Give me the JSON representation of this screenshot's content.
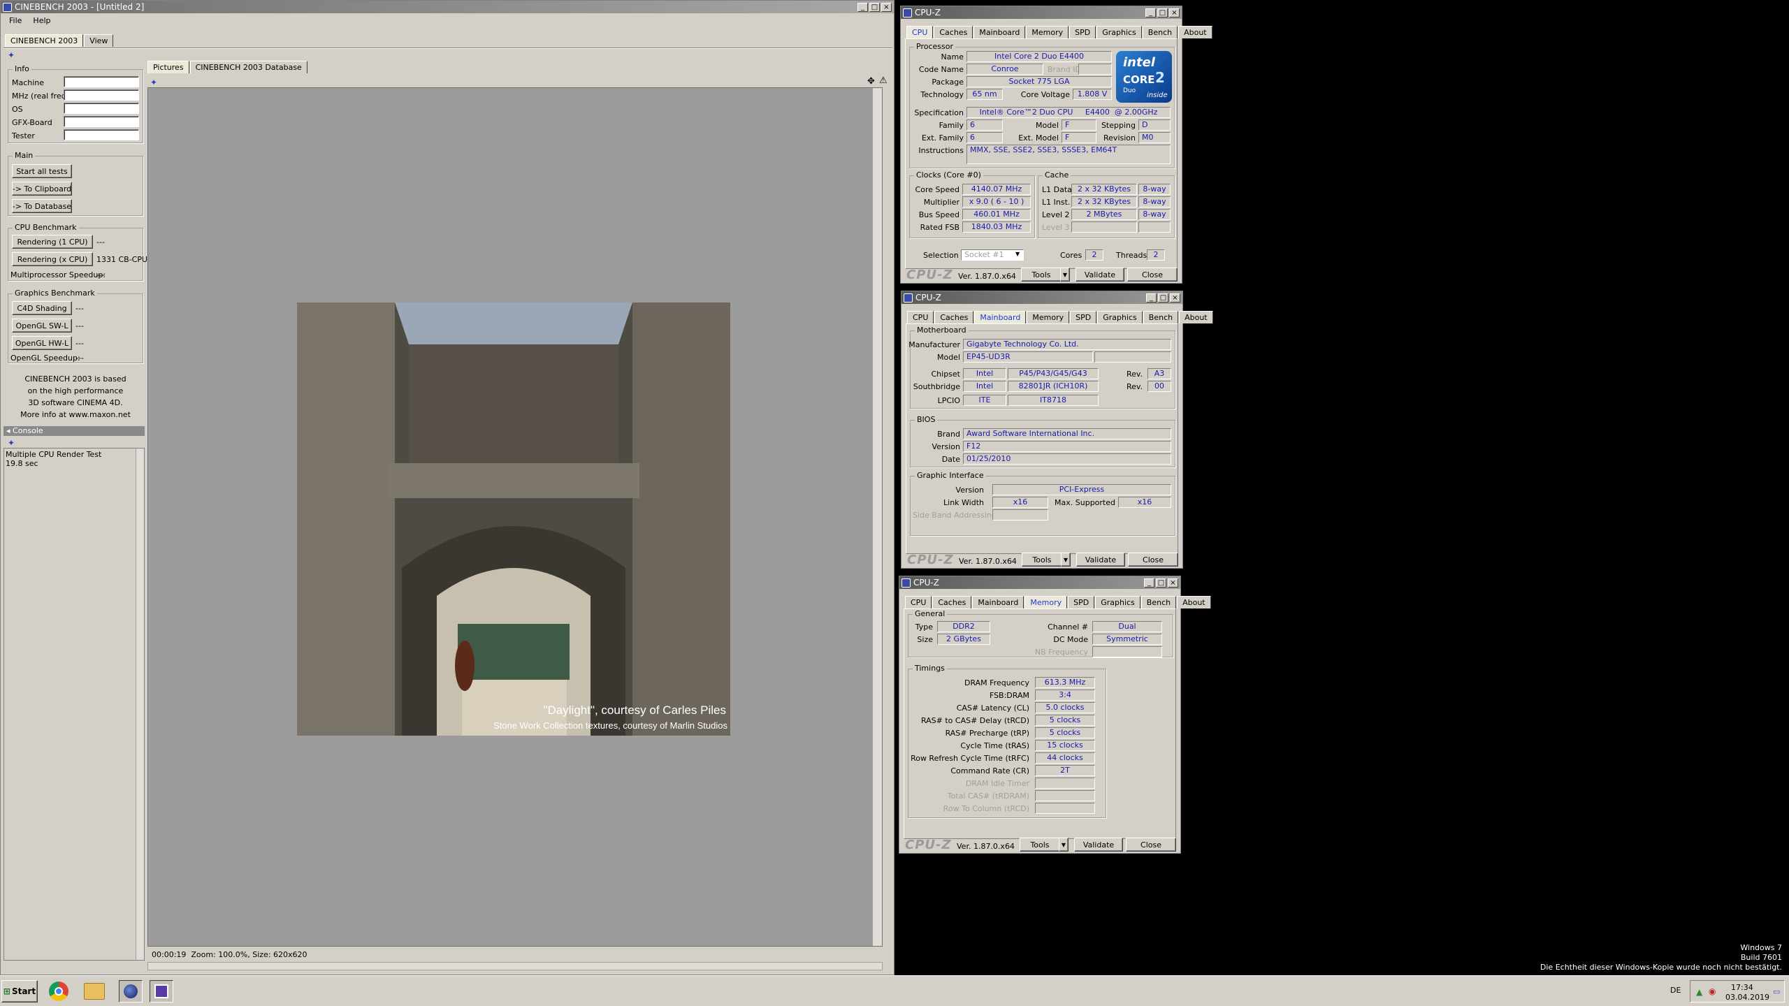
{
  "cb": {
    "title": "CINEBENCH 2003 - [Untitled 2]",
    "menu": [
      "File",
      "Help"
    ],
    "tabs": [
      "CINEBENCH 2003",
      "View"
    ],
    "info": {
      "title": "Info",
      "labels": [
        "Machine",
        "MHz (real freq.)",
        "OS",
        "GFX-Board",
        "Tester"
      ]
    },
    "main": {
      "title": "Main",
      "buttons": [
        "Start all tests",
        "-> To Clipboard",
        "-> To Database"
      ]
    },
    "cpu": {
      "title": "CPU Benchmark",
      "r1": "Rendering (1 CPU)",
      "r1v": "---",
      "rx": "Rendering (x CPU)",
      "rxv": "1331 CB-CPU",
      "mp": "Multiprocessor Speedup:",
      "mpv": "---"
    },
    "gfx": {
      "title": "Graphics Benchmark",
      "b": [
        "C4D Shading",
        "OpenGL SW-L",
        "OpenGL HW-L"
      ],
      "bv": "---",
      "sp": "OpenGL Speedup:",
      "spv": "---"
    },
    "about": [
      "CINEBENCH 2003 is based",
      "on the high performance",
      "3D software CINEMA 4D.",
      "More info at www.maxon.net"
    ],
    "console": {
      "title": "Console",
      "lines": [
        "Multiple CPU Render Test",
        "19.8 sec"
      ]
    },
    "pictabs": [
      "Pictures",
      "CINEBENCH 2003 Database"
    ],
    "caption1": "\"Daylight\", courtesy of Carles Piles",
    "caption2": "Stone Work Collection textures, courtesy of Marlin Studios",
    "status": "00:00:19  Zoom: 100.0%, Size: 620x620"
  },
  "cz": {
    "title": "CPU-Z",
    "tabs": [
      "CPU",
      "Caches",
      "Mainboard",
      "Memory",
      "SPD",
      "Graphics",
      "Bench",
      "About"
    ],
    "ver": "Ver. 1.87.0.x64",
    "tools": "Tools",
    "validate": "Validate",
    "close": "Close",
    "logo": "CPU-Z",
    "cpu": {
      "group": "Processor",
      "name_l": "Name",
      "name": "Intel Core 2 Duo E4400",
      "code_l": "Code Name",
      "code": "Conroe",
      "brand_l": "Brand ID",
      "pkg_l": "Package",
      "pkg": "Socket 775 LGA",
      "tech_l": "Technology",
      "tech": "65 nm",
      "cv_l": "Core Voltage",
      "cv": "1.808 V",
      "spec_l": "Specification",
      "spec": "Intel® Core™2 Duo CPU     E4400  @ 2.00GHz",
      "fam_l": "Family",
      "fam": "6",
      "mod_l": "Model",
      "mod": "F",
      "step_l": "Stepping",
      "step": "D",
      "efam_l": "Ext. Family",
      "efam": "6",
      "emod_l": "Ext. Model",
      "emod": "F",
      "rev_l": "Revision",
      "rev": "M0",
      "ins_l": "Instructions",
      "ins": "MMX, SSE, SSE2, SSE3, SSSE3, EM64T",
      "clk_g": "Clocks (Core #0)",
      "cs_l": "Core Speed",
      "cs": "4140.07 MHz",
      "mul_l": "Multiplier",
      "mul": "x 9.0 ( 6 - 10 )",
      "bus_l": "Bus Speed",
      "bus": "460.01 MHz",
      "fsb_l": "Rated FSB",
      "fsb": "1840.03 MHz",
      "cache_g": "Cache",
      "l1d_l": "L1 Data",
      "l1d": "2 x 32 KBytes",
      "l1d_w": "8-way",
      "l1i_l": "L1 Inst.",
      "l1i": "2 x 32 KBytes",
      "l1i_w": "8-way",
      "l2_l": "Level 2",
      "l2": "2 MBytes",
      "l2_w": "8-way",
      "l3_l": "Level 3",
      "sel_l": "Selection",
      "sel": "Socket #1",
      "cores_l": "Cores",
      "cores": "2",
      "thr_l": "Threads",
      "thr": "2",
      "intel1": "intel",
      "intel2": "CORE",
      "intel3": "2",
      "intel4": "Duo",
      "intel5": "inside"
    },
    "mb": {
      "group": "Motherboard",
      "man_l": "Manufacturer",
      "man": "Gigabyte Technology Co. Ltd.",
      "model_l": "Model",
      "model": "EP45-UD3R",
      "chip_l": "Chipset",
      "chip1": "Intel",
      "chip2": "P45/P43/G45/G43",
      "chiprev_l": "Rev.",
      "chiprev": "A3",
      "sb_l": "Southbridge",
      "sb1": "Intel",
      "sb2": "82801JR (ICH10R)",
      "sbrev_l": "Rev.",
      "sbrev": "00",
      "lpc_l": "LPCIO",
      "lpc1": "ITE",
      "lpc2": "IT8718",
      "bios_g": "BIOS",
      "brand_l": "Brand",
      "brand": "Award Software International Inc.",
      "ver_l": "Version",
      "ver": "F12",
      "date_l": "Date",
      "date": "01/25/2010",
      "gi_g": "Graphic Interface",
      "giv_l": "Version",
      "giv": "PCI-Express",
      "lw_l": "Link Width",
      "lw": "x16",
      "ms_l": "Max. Supported",
      "ms": "x16",
      "sba_l": "Side Band Addressing"
    },
    "mem": {
      "group": "General",
      "type_l": "Type",
      "type": "DDR2",
      "size_l": "Size",
      "size": "2 GBytes",
      "ch_l": "Channel #",
      "ch": "Dual",
      "dc_l": "DC Mode",
      "dc": "Symmetric",
      "nb_l": "NB Frequency",
      "tim_g": "Timings",
      "rows": [
        [
          "DRAM Frequency",
          "613.3 MHz"
        ],
        [
          "FSB:DRAM",
          "3:4"
        ],
        [
          "CAS# Latency (CL)",
          "5.0 clocks"
        ],
        [
          "RAS# to CAS# Delay (tRCD)",
          "5 clocks"
        ],
        [
          "RAS# Precharge (tRP)",
          "5 clocks"
        ],
        [
          "Cycle Time (tRAS)",
          "15 clocks"
        ],
        [
          "Row Refresh Cycle Time (tRFC)",
          "44 clocks"
        ],
        [
          "Command Rate (CR)",
          "2T"
        ],
        [
          "DRAM Idle Timer",
          ""
        ],
        [
          "Total CAS# (tRDRAM)",
          ""
        ],
        [
          "Row To Column (tRCD)",
          ""
        ]
      ]
    }
  },
  "desktop": {
    "os": "Windows 7",
    "build": "Build 7601",
    "notice": "Die Echtheit dieser Windows-Kopie wurde noch nicht bestätigt."
  },
  "taskbar": {
    "start": "Start",
    "lang": "DE",
    "time": "17:34",
    "date": "03.04.2019"
  }
}
